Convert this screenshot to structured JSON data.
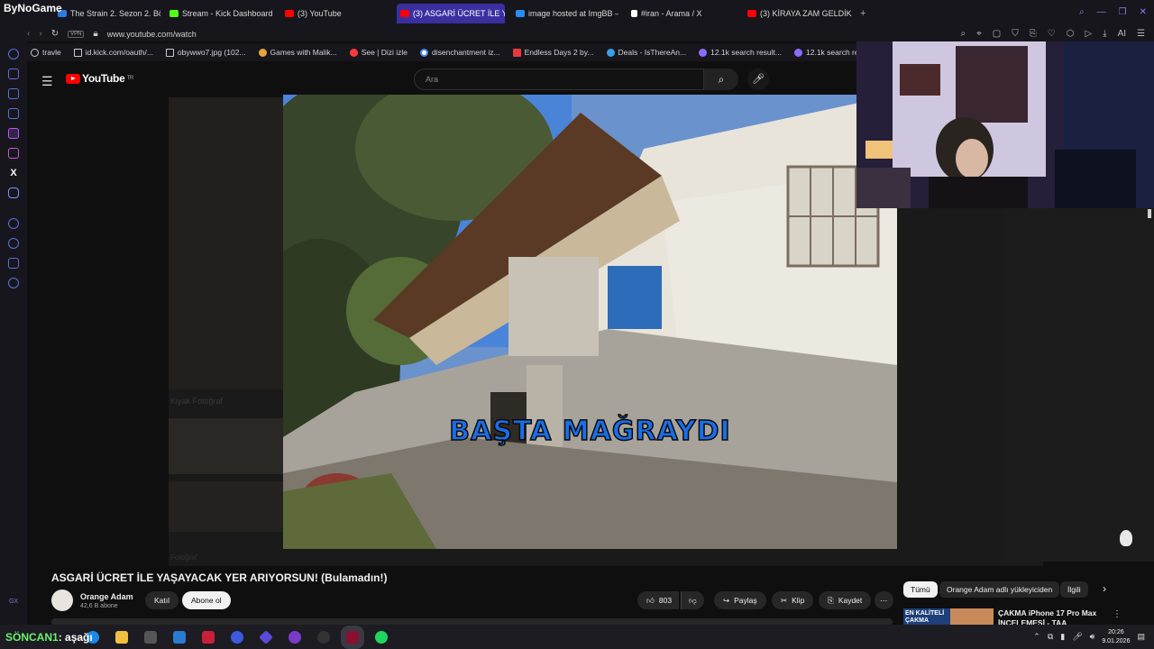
{
  "browser": {
    "corner_label": "ByNoGame",
    "tabs": [
      {
        "label": "The Strain 2. Sezon 2. Bölü",
        "color": "#2d7be0"
      },
      {
        "label": "Stream - Kick Dashboard",
        "color": "#53fc18"
      },
      {
        "label": "(3) YouTube",
        "color": "#ff0000"
      },
      {
        "label": "(3) ASGARİ ÜCRET İLE YA",
        "color": "#ff0000"
      },
      {
        "label": "image hosted at ImgBB —",
        "color": "#2a8cf0"
      },
      {
        "label": "#iran - Arama / X",
        "color": "#ffffff"
      },
      {
        "label": "(3) KİRAYA ZAM GELDİKÇ",
        "color": "#ff0000"
      }
    ],
    "address": "www.youtube.com/watch",
    "vpn_label": "VPN",
    "bookmarks": [
      {
        "label": "travle",
        "color": "#cccccc"
      },
      {
        "label": "id.kick.com/oauth/...",
        "color": "#cccccc"
      },
      {
        "label": "obywwo7.jpg (102...",
        "color": "#cccccc"
      },
      {
        "label": "Games with Malik...",
        "color": "#e8a23a"
      },
      {
        "label": "See | Dizi izle",
        "color": "#ff3b3b"
      },
      {
        "label": "disenchantment iz...",
        "color": "#4a8af4"
      },
      {
        "label": "Endless Days 2 by...",
        "color": "#e83a3a"
      },
      {
        "label": "Deals - IsThereAn...",
        "color": "#3aa0e8"
      },
      {
        "label": "12.1k search result...",
        "color": "#8a6cff"
      },
      {
        "label": "12.1k search res",
        "color": "#8a6cff"
      }
    ],
    "tool_ai": "AI"
  },
  "sidebar": {
    "bottom_label": "GX"
  },
  "youtube": {
    "logo_text": "YouTube",
    "logo_region": "TR",
    "search_placeholder": "Ara",
    "video": {
      "caption": "BAŞTA MAĞRAYDI",
      "title": "ASGARİ ÜCRET İLE YAŞAYACAK YER ARIYORSUN! (Bulamadın!)"
    },
    "channel": {
      "name": "Orange Adam",
      "subs": "42,6 B abone"
    },
    "join_label": "Katıl",
    "subscribe_label": "Abone ol",
    "likes": "803",
    "share_label": "Paylaş",
    "clip_label": "Klip",
    "save_label": "Kaydet",
    "chips": [
      "Tümü",
      "Orange Adam adlı yükleyiciden",
      "İlgili"
    ],
    "recommendation": {
      "title": "ÇAKMA iPhone 17 Pro Max İNCELEMESİ - TAA",
      "thumb_text": "EN KALİTELİ ÇAKMA"
    },
    "bg_label_1": "Kiyak Fotoğraf",
    "bg_label_2": "Fotoğraf"
  },
  "stream_chat": {
    "user": "SÖNCAN1",
    "message": ": aşağı"
  },
  "taskbar": {
    "time": "20:26",
    "date": "9.01.2026"
  }
}
